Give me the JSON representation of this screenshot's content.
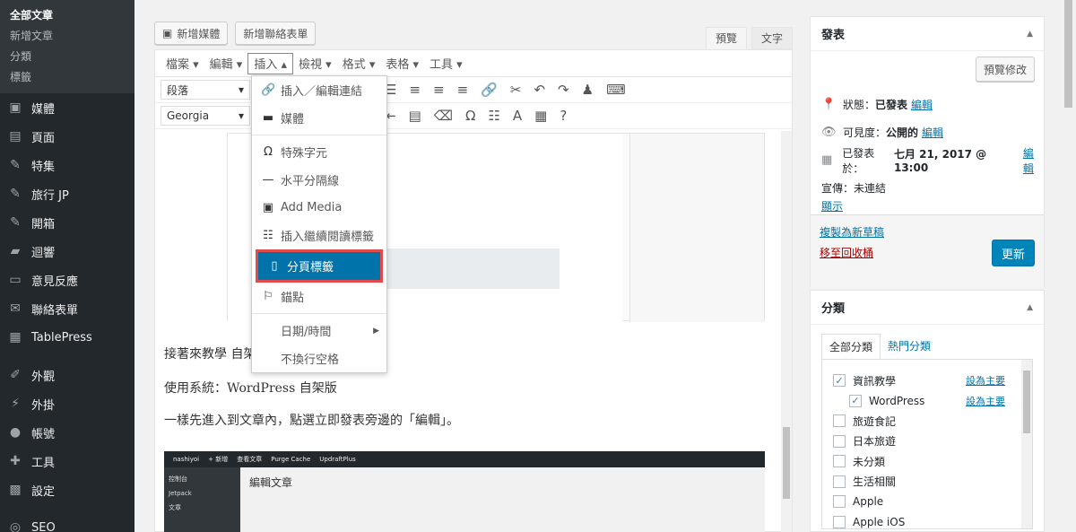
{
  "sidebar": {
    "submenu": [
      "全部文章",
      "新增文章",
      "分類",
      "標籤"
    ],
    "menu": [
      {
        "label": "媒體",
        "icon": "media-icon"
      },
      {
        "label": "頁面",
        "icon": "page-icon"
      },
      {
        "label": "特集",
        "icon": "pin-icon"
      },
      {
        "label": "旅行 JP",
        "icon": "pin-icon"
      },
      {
        "label": "開箱",
        "icon": "pin-icon"
      },
      {
        "label": "迴響",
        "icon": "comment-icon"
      },
      {
        "label": "意見反應",
        "icon": "feedback-icon"
      },
      {
        "label": "聯絡表單",
        "icon": "mail-icon"
      },
      {
        "label": "TablePress",
        "icon": "table-icon"
      },
      {
        "label": "外觀",
        "icon": "brush-icon"
      },
      {
        "label": "外掛",
        "icon": "plugin-icon"
      },
      {
        "label": "帳號",
        "icon": "user-icon"
      },
      {
        "label": "工具",
        "icon": "wrench-icon"
      },
      {
        "label": "設定",
        "icon": "settings-icon"
      },
      {
        "label": "SEO",
        "icon": "seo-icon"
      }
    ]
  },
  "editor": {
    "add_media": "新增媒體",
    "add_form": "新增聯絡表單",
    "tab_visual": "預覽",
    "tab_text": "文字",
    "menubar": [
      "檔案 ▾",
      "編輯 ▾",
      "插入 ▴",
      "檢視 ▾",
      "格式 ▾",
      "表格 ▾",
      "工具 ▾"
    ],
    "format_select": "段落",
    "font_select": "Georgia",
    "para1": "接著來教學 自架",
    "para2": "使用系統：WordPress 自架版",
    "para3": "一樣先進入到文章內，點選立即發表旁邊的「編輯」。",
    "shot2_title": "編輯文章",
    "shot2_bar": [
      "nashiyoi",
      "+ 新增",
      "查看文章",
      "Purge Cache",
      "UpdraftPlus"
    ],
    "shot2_side": [
      "控制台",
      "Jetpack",
      "文章"
    ]
  },
  "dropdown": {
    "items": [
      {
        "label": "插入／編輯連結",
        "icon": "link-icon"
      },
      {
        "label": "媒體",
        "icon": "film-icon"
      },
      {
        "label": "特殊字元",
        "icon": "omega-icon"
      },
      {
        "label": "水平分隔線",
        "icon": "hr-icon"
      },
      {
        "label": "Add Media",
        "icon": "media-icon"
      },
      {
        "label": "插入繼續閱讀標籤",
        "icon": "more-icon"
      },
      {
        "label": "分頁標籤",
        "icon": "pagebreak-icon"
      },
      {
        "label": "錨點",
        "icon": "bookmark-icon"
      },
      {
        "label": "日期/時間",
        "icon": ""
      },
      {
        "label": "不換行空格",
        "icon": ""
      }
    ]
  },
  "publish": {
    "title": "發表",
    "preview": "預覽修改",
    "status_label": "狀態：",
    "status_value": "已發表",
    "visibility_label": "可見度：",
    "visibility_value": "公開的",
    "published_label": "已發表於：",
    "published_value": "七月 21, 2017 @ 13:00",
    "edit": "編輯",
    "promote_label": "宣傳：",
    "promote_value": "未連結",
    "show": "顯示",
    "copy_draft": "複製為新草稿",
    "trash": "移至回收桶",
    "update": "更新"
  },
  "categories": {
    "title": "分類",
    "tab_all": "全部分類",
    "tab_popular": "熱門分類",
    "make_primary": "設為主要",
    "items": [
      {
        "label": "資訊教學",
        "checked": "✓",
        "primary": true,
        "indent": false
      },
      {
        "label": "WordPress",
        "checked": "✓",
        "primary": true,
        "indent": true
      },
      {
        "label": "旅遊食記",
        "checked": "",
        "primary": false,
        "indent": false
      },
      {
        "label": "日本旅遊",
        "checked": "",
        "primary": false,
        "indent": false
      },
      {
        "label": "未分類",
        "checked": "",
        "primary": false,
        "indent": false
      },
      {
        "label": "生活相關",
        "checked": "",
        "primary": false,
        "indent": false
      },
      {
        "label": "Apple",
        "checked": "",
        "primary": false,
        "indent": false
      },
      {
        "label": "Apple iOS",
        "checked": "",
        "primary": false,
        "indent": false
      }
    ]
  }
}
